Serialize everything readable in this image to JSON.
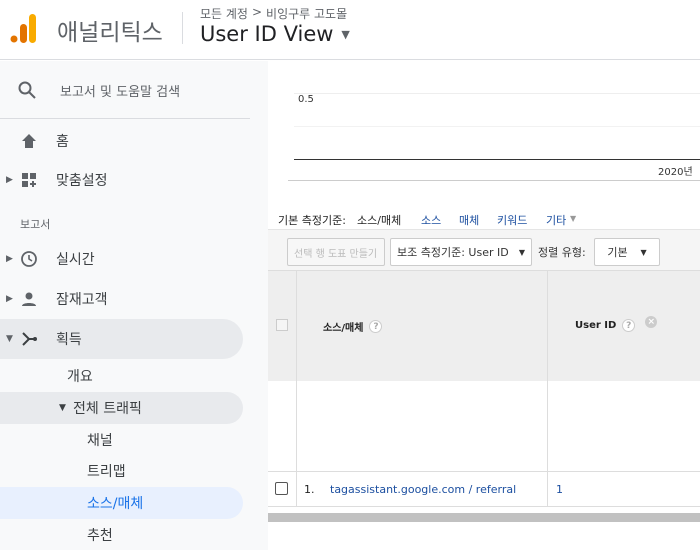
{
  "header": {
    "app_name": "애널리틱스",
    "breadcrumb_account": "모든 계정",
    "breadcrumb_sep": ">",
    "breadcrumb_property": "비잉구루 고도몰",
    "view_name": "User ID View"
  },
  "sidebar": {
    "search_placeholder": "보고서 및 도움말 검색",
    "home": "홈",
    "customization": "맞춤설정",
    "reports_section": "보고서",
    "realtime": "실시간",
    "audience": "잠재고객",
    "acquisition": "획득",
    "overview": "개요",
    "all_traffic": "전체 트래픽",
    "channels": "채널",
    "treemap": "트리맵",
    "source_medium": "소스/매체",
    "referrals": "추천"
  },
  "chart": {
    "y_tick": "0.5",
    "x_tick": "2020년"
  },
  "dimension_bar": {
    "label": "기본 측정기준:",
    "current": "소스/매체",
    "options": [
      "소스",
      "매체",
      "키워드",
      "기타"
    ]
  },
  "toolbar": {
    "plot_rows": "선택 행 도표 만들기",
    "secondary_dimension": "보조 측정기준: User ID",
    "sort_label": "정렬 유형:",
    "sort_value": "기본"
  },
  "table": {
    "col_source": "소스/매체",
    "col_userid": "User ID",
    "rows": [
      {
        "index": "1.",
        "source": "tagassistant.google.com / referral",
        "userid": "1"
      }
    ]
  },
  "colors": {
    "accent": "#1a73e8",
    "logo_orange": "#f9ab00",
    "logo_dark": "#e37400"
  }
}
